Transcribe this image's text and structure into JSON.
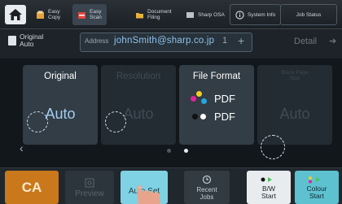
{
  "tabs": [
    {
      "label": "Easy\nCopy",
      "icon": "copy-icon"
    },
    {
      "label": "Easy\nScan",
      "icon": "scan-icon"
    },
    {
      "label": "Document\nFiling",
      "icon": "folder-icon"
    },
    {
      "label": "Sharp OSA",
      "icon": "app-icon"
    },
    {
      "label": "System Info",
      "icon": "info-icon"
    },
    {
      "label": "Job Status",
      "icon": ""
    }
  ],
  "original": {
    "mode": "Original\nAuto",
    "icon": "original-document-icon"
  },
  "address": {
    "label": "Address",
    "value": "johnSmith@sharp.co.jp",
    "count": "1",
    "add": "+"
  },
  "detail": {
    "label": "Detail",
    "arrow": "➔"
  },
  "cards": {
    "original": {
      "title": "Original",
      "value": "Auto"
    },
    "resolution": {
      "title": "Resolution",
      "value": "Auto"
    },
    "file_format": {
      "title": "File Format",
      "color_format": "PDF",
      "bw_format": "PDF"
    },
    "blank_page_skip": {
      "title": "Blank Page\nSkip",
      "value": "Auto"
    }
  },
  "pager": {
    "left_arrow": "‹",
    "pages": 2,
    "current": 2
  },
  "bottom_bar": {
    "ca": "CA",
    "preview": "Preview",
    "auto_set": "Auto Set",
    "recent_jobs": "Recent\nJobs",
    "bw_start": "B/W\nStart",
    "colour_start": "Colour\nStart"
  },
  "colors": {
    "accent": "#c9781c",
    "scan_blue": "#7fd2e3",
    "colour_start": "#5ec1d0",
    "value_blue": "#a5cdee"
  }
}
